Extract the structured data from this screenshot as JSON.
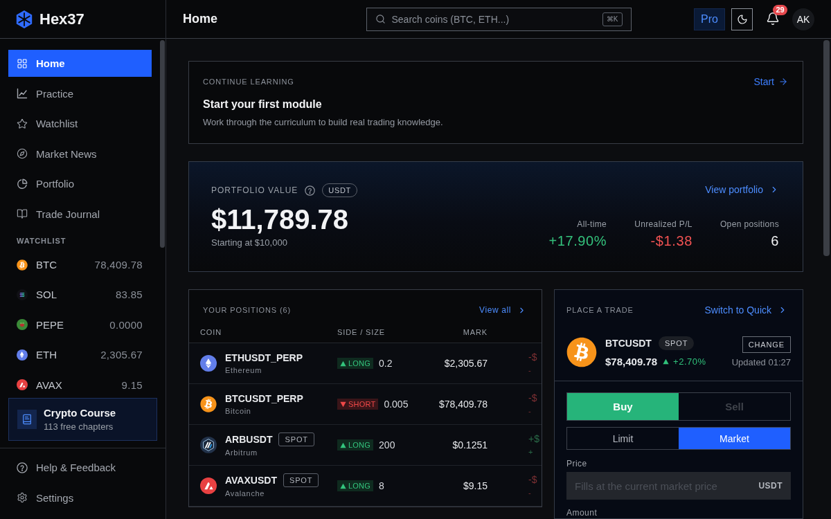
{
  "sidebar": {
    "brand": "Hex37",
    "nav": [
      {
        "label": "Home",
        "selected": true
      },
      {
        "label": "Practice",
        "selected": false
      },
      {
        "label": "Watchlist",
        "selected": false
      },
      {
        "label": "Market News",
        "selected": false
      },
      {
        "label": "Portfolio",
        "selected": false
      },
      {
        "label": "Trade Journal",
        "selected": false
      }
    ],
    "watchlist_title": "WATCHLIST",
    "watchlist": [
      {
        "symbol": "BTC",
        "price": "78,409.78"
      },
      {
        "symbol": "SOL",
        "price": "83.85"
      },
      {
        "symbol": "PEPE",
        "price": "0.0000"
      },
      {
        "symbol": "ETH",
        "price": "2,305.67"
      },
      {
        "symbol": "AVAX",
        "price": "9.15"
      }
    ],
    "course": {
      "title": "Crypto Course",
      "subtitle": "113 free chapters"
    },
    "footer": [
      {
        "label": "Help & Feedback"
      },
      {
        "label": "Settings"
      }
    ]
  },
  "header": {
    "title": "Home",
    "search": {
      "placeholder": "Search coins (BTC, ETH...)",
      "shortcut": "⌘K"
    },
    "plan": "Pro",
    "notifications": "29",
    "avatar": "AK"
  },
  "learning": {
    "eyebrow": "CONTINUE LEARNING",
    "link": "Start",
    "title": "Start your first module",
    "description": "Work through the curriculum to build real trading knowledge."
  },
  "portfolio": {
    "label": "PORTFOLIO VALUE",
    "currency": "USDT",
    "value": "$11,789.78",
    "subtitle": "Starting at $10,000",
    "link": "View portfolio",
    "stats": [
      {
        "label": "All-time",
        "value": "+17.90%",
        "kind": "gain"
      },
      {
        "label": "Unrealized P/L",
        "value": "-$1.38",
        "kind": "loss"
      },
      {
        "label": "Open positions",
        "value": "6",
        "kind": "neutral"
      }
    ]
  },
  "positions": {
    "title": "YOUR POSITIONS (6)",
    "link": "View all",
    "columns": [
      "COIN",
      "SIDE / SIZE",
      "MARK"
    ],
    "rows": [
      {
        "symbol": "ETHUSDT_PERP",
        "name": "Ethereum",
        "side": "LONG",
        "kind": "long",
        "size": "0.2",
        "mark": "$2,305.67",
        "column_4": {
          "kind": "loss",
          "line_1": "-$",
          "line_2": "-"
        }
      },
      {
        "symbol": "BTCUSDT_PERP",
        "name": "Bitcoin",
        "side": "SHORT",
        "kind": "short",
        "size": "0.005",
        "mark": "$78,409.78",
        "column_4": {
          "kind": "loss",
          "line_1": "-$",
          "line_2": "-"
        }
      },
      {
        "symbol": "ARBUSDT",
        "badge": "SPOT",
        "name": "Arbitrum",
        "side": "LONG",
        "kind": "long",
        "size": "200",
        "mark": "$0.1251",
        "column_4": {
          "kind": "gain",
          "line_1": "+$",
          "line_2": "+"
        }
      },
      {
        "symbol": "AVAXUSDT",
        "badge": "SPOT",
        "name": "Avalanche",
        "side": "LONG",
        "kind": "long",
        "size": "8",
        "mark": "$9.15",
        "column_4": {
          "kind": "loss",
          "line_1": "-$",
          "line_2": "-"
        }
      }
    ]
  },
  "trade": {
    "title": "PLACE A TRADE",
    "link": "Switch to Quick",
    "pair": "BTCUSDT",
    "market": "SPOT",
    "price": "$78,409.78",
    "change": {
      "kind": "up",
      "text": "+2.70%"
    },
    "change_button": "CHANGE",
    "updated": "Updated 01:27",
    "sides": [
      {
        "label": "Buy",
        "selected": true
      },
      {
        "label": "Sell",
        "selected": false
      }
    ],
    "order_types": [
      {
        "label": "Limit",
        "selected": false
      },
      {
        "label": "Market",
        "selected": true
      }
    ],
    "price_field": {
      "label": "Price",
      "placeholder": "Fills at the current market price",
      "unit": "USDT"
    },
    "amount_label": "Amount"
  }
}
